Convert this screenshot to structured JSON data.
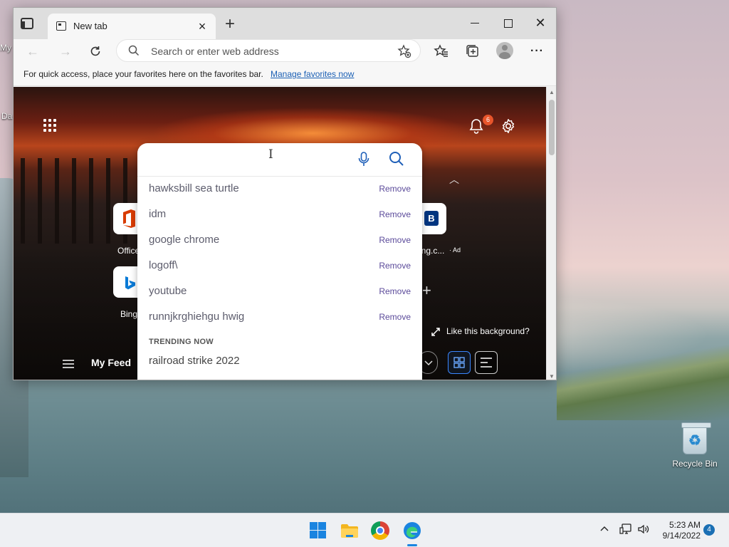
{
  "desktop": {
    "icon_partial_1": "My",
    "icon_partial_2": "Da",
    "recycle_bin_label": "Recycle Bin"
  },
  "browser": {
    "tab_title": "New tab",
    "address_placeholder": "Search or enter web address",
    "favorites_bar": {
      "message": "For quick access, place your favorites here on the favorites bar.",
      "link": "Manage favorites now"
    }
  },
  "new_tab_page": {
    "notification_count": "6",
    "tiles": {
      "office_label": "Office",
      "booking_label": "ing.c...",
      "booking_letter": "B",
      "ad_label": "· Ad",
      "bing_label": "Bing"
    },
    "like_background": "Like this background?",
    "feed_title": "My Feed"
  },
  "search_dropdown": {
    "suggestions": [
      {
        "query": "hawksbill sea turtle",
        "action": "Remove"
      },
      {
        "query": "idm",
        "action": "Remove"
      },
      {
        "query": "google chrome",
        "action": "Remove"
      },
      {
        "query": "logoff\\",
        "action": "Remove"
      },
      {
        "query": "youtube",
        "action": "Remove"
      },
      {
        "query": "runnjkrghiehgu hwig",
        "action": "Remove"
      }
    ],
    "trending_header": "TRENDING NOW",
    "trending": [
      "railroad strike 2022"
    ]
  },
  "taskbar": {
    "time": "5:23 AM",
    "date": "9/14/2022",
    "notification_count": "4"
  },
  "colors": {
    "accent": "#1a84e0",
    "link": "#1a5fb4",
    "remove_text": "#5b4a9a",
    "badge": "#e8552b"
  }
}
